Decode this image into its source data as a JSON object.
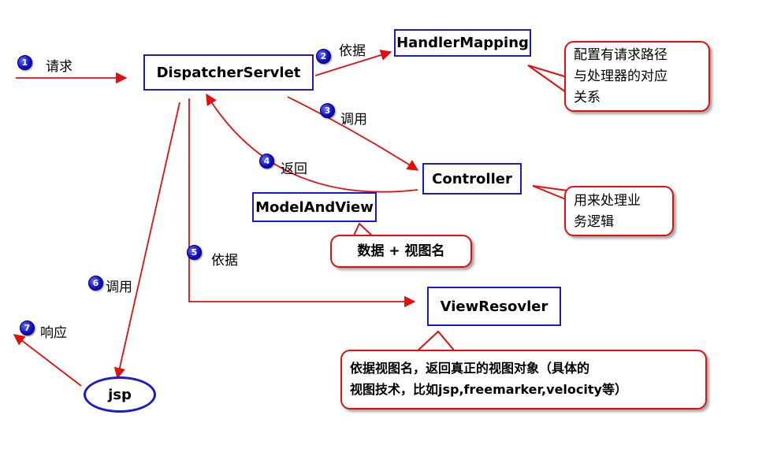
{
  "nodes": {
    "dispatcher": "DispatcherServlet",
    "handler_mapping": "HandlerMapping",
    "controller": "Controller",
    "model_and_view": "ModelAndView",
    "view_resolver": "ViewResovler",
    "jsp": "jsp"
  },
  "steps": [
    {
      "num": "1",
      "label": "请求"
    },
    {
      "num": "2",
      "label": "依据"
    },
    {
      "num": "3",
      "label": "调用"
    },
    {
      "num": "4",
      "label": "返回"
    },
    {
      "num": "5",
      "label": "依据"
    },
    {
      "num": "6",
      "label": "调用"
    },
    {
      "num": "7",
      "label": "响应"
    }
  ],
  "callouts": {
    "handler_mapping_note": [
      "配置有请求路径",
      "与处理器的对应",
      "关系"
    ],
    "controller_note": [
      "用来处理业",
      "务逻辑"
    ],
    "model_note": "数据 + 视图名",
    "view_resolver_note": [
      "依据视图名，返回真正的视图对象（具体的",
      "视图技术，比如jsp,freemarker,velocity等）"
    ]
  },
  "colors": {
    "arrow": "#e01010",
    "box_border": "#1a1acc",
    "badge": "#1010c8"
  }
}
